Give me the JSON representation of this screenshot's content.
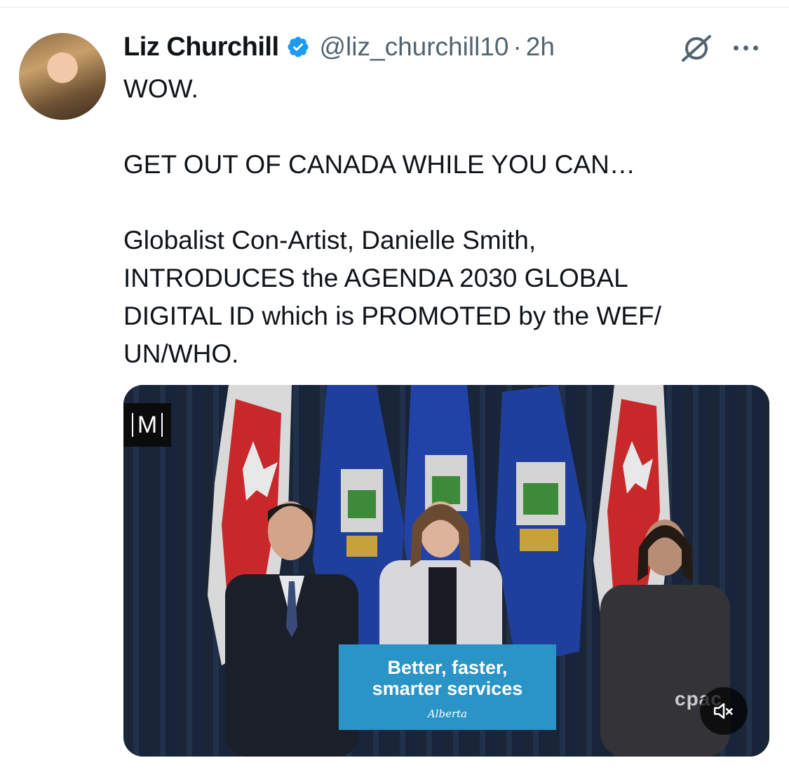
{
  "tweet": {
    "author_name": "Liz Churchill",
    "handle": "@liz_churchill10",
    "separator": "·",
    "time": "2h",
    "text": "WOW.\n\nGET OUT OF CANADA WHILE YOU CAN…\n\nGlobalist Con-Artist, Danielle Smith,\nINTRODUCES the AGENDA 2030 GLOBAL\nDIGITAL ID which is PROMOTED by the WEF/\nUN/WHO."
  },
  "media": {
    "logo_letter": "M",
    "podium_line1": "Better, faster,",
    "podium_line2": "smarter services",
    "podium_brand": "Alberta",
    "watermark": "cpac"
  },
  "icons": {
    "verified": "verified-badge-icon",
    "grok": "grok-icon",
    "more": "more-options-icon",
    "mute": "muted-speaker-icon"
  },
  "colors": {
    "verified": "#1d9bf0",
    "secondary_text": "#536471",
    "podium": "#2a94c6"
  }
}
